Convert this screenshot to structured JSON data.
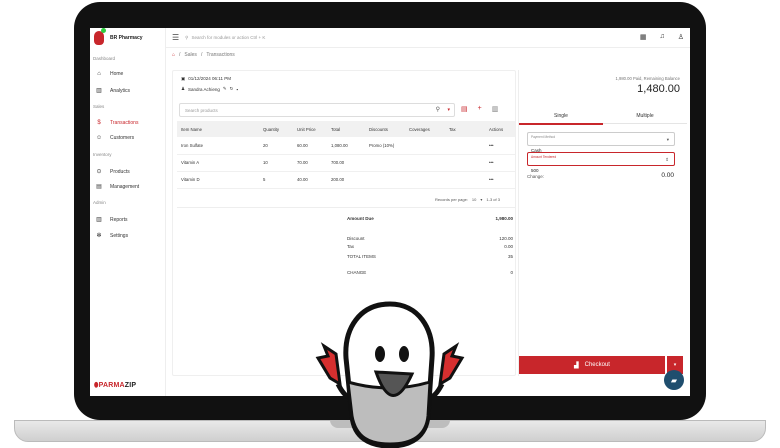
{
  "app": {
    "name": "BR Pharmacy",
    "footer_brand_a": "PARMA",
    "footer_brand_b": "ZIP"
  },
  "sidebar": {
    "sections": [
      "Dashboard",
      "Sales",
      "Inventory",
      "Admin"
    ],
    "items": [
      {
        "label": "Home",
        "icon": "home-icon"
      },
      {
        "label": "Analytics",
        "icon": "chart-icon"
      },
      {
        "label": "Transactions",
        "icon": "dollar-icon"
      },
      {
        "label": "Customers",
        "icon": "users-icon"
      },
      {
        "label": "Products",
        "icon": "box-icon"
      },
      {
        "label": "Management",
        "icon": "clipboard-icon"
      },
      {
        "label": "Reports",
        "icon": "chart-icon"
      },
      {
        "label": "Settings",
        "icon": "gear-icon"
      }
    ]
  },
  "topbar": {
    "search_placeholder": "Search for modules or action   Ctrl + K"
  },
  "breadcrumb": {
    "sales": "Sales",
    "transactions": "Transactions"
  },
  "transaction": {
    "datetime": "01/12/2024 06:11 PM",
    "user": "Sandra Achieng"
  },
  "products": {
    "search_placeholder": "Search products"
  },
  "table": {
    "headers": [
      "Item Name",
      "Quantity",
      "Unit Price",
      "Total",
      "Discounts",
      "Coverages",
      "Tax",
      "Actions"
    ],
    "rows": [
      {
        "name": "Iron Sulfate",
        "qty": "20",
        "price": "60.00",
        "total": "1,080.00",
        "discount": "Promo (10%)",
        "coverage": "",
        "tax": "",
        "action": "•••"
      },
      {
        "name": "Vitamin A",
        "qty": "10",
        "price": "70.00",
        "total": "700.00",
        "discount": "",
        "coverage": "",
        "tax": "",
        "action": "•••"
      },
      {
        "name": "Vitamin D",
        "qty": "5",
        "price": "40.00",
        "total": "200.00",
        "discount": "",
        "coverage": "",
        "tax": "",
        "action": "•••"
      }
    ],
    "pager": {
      "label": "Records per page:",
      "per_page": "10",
      "range": "1-3 of 3"
    }
  },
  "summary": {
    "amount_due_label": "Amount Due",
    "amount_due": "1,980.00",
    "discount_label": "Discount",
    "discount": "120.00",
    "tax_label": "Tax",
    "tax": "0.00",
    "items_label": "TOTAL ITEMS",
    "items": "35",
    "change_label": "CHANGE",
    "change": "0"
  },
  "payment": {
    "remaining_label": "1,980.00 Paid, Remaining Balance",
    "remaining": "1,480.00",
    "tabs": [
      "Single",
      "Multiple"
    ],
    "method_label": "Payment Method",
    "method": "Cash",
    "tendered_label": "Amount Tendered",
    "tendered": "500",
    "change_label": "Change:",
    "change": "0.00",
    "checkout": "Checkout"
  },
  "colors": {
    "accent": "#c8262b"
  }
}
